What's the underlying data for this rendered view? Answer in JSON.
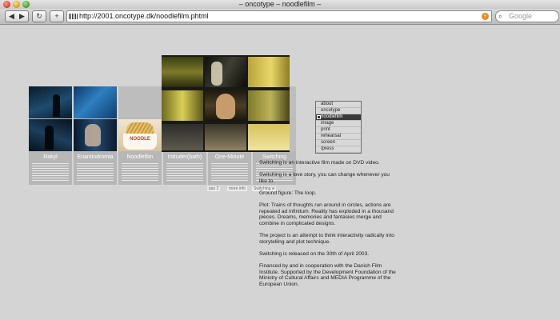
{
  "window": {
    "title": "– oncotype – noodlefilm –"
  },
  "toolbar": {
    "back_icon": "◀",
    "forward_icon": "▶",
    "reload_icon": "↻",
    "add_icon": "+",
    "url": "http://2001.oncotype.dk/noodlefilm.phtml",
    "search_placeholder": "Google"
  },
  "films": [
    {
      "title": "Rakyl"
    },
    {
      "title": "Enantiodromia"
    },
    {
      "title": "Noodlefilm",
      "shot_label": "NOODLE"
    },
    {
      "title": "Intruder(bath)"
    },
    {
      "title": "One-Minute"
    },
    {
      "title": "Switching"
    }
  ],
  "letters": "LE",
  "small_buttons": [
    "pas 2",
    "more info",
    "Switching w"
  ],
  "menu": {
    "items": [
      "about",
      "oncotype",
      "noodlefilm",
      "image",
      "print",
      "rehearsal",
      "screen",
      "/press"
    ],
    "active_index": 2
  },
  "article": {
    "paragraphs": [
      "Switching is an interactive film made on DVD video.",
      "Switching is a love story, you can change whenever you like to.",
      "Ground figure: The loop.",
      "Plot: Trains of thoughts run around in circles, actions are repeated ad infinitum. Reality has exploded in a thousand pieces. Dreams, memories and fantasies merge and combine in complicated designs.",
      "The project is an attempt to think interactivity radically into storytelling and plot technique.",
      "Switching is released on the 30th of April 2003.",
      "Financed by and in cooperation with the Danish Film Institute. Supported by the Development Foundation of the Ministry of Cultural Affairs and MEDIA Programme of the European Union."
    ]
  },
  "colors": {
    "page_bg": "#d4d4d4",
    "menu_active": "#3a3a3a"
  },
  "icons": [
    "close-icon",
    "minimize-icon",
    "maximize-icon",
    "back-icon",
    "forward-icon",
    "reload-icon",
    "add-icon",
    "rss-icon",
    "search-icon"
  ]
}
